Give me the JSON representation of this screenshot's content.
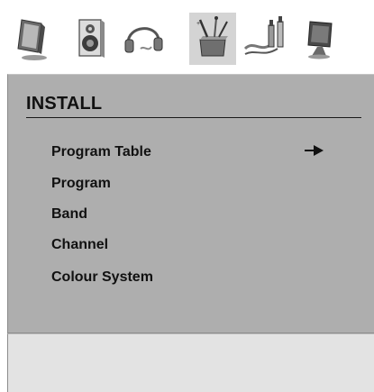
{
  "toolbar": {
    "icons": [
      {
        "name": "tv-screen-icon",
        "active": false
      },
      {
        "name": "speaker-icon",
        "active": false
      },
      {
        "name": "headphones-icon",
        "active": false
      },
      {
        "name": "tools-box-icon",
        "active": true
      },
      {
        "name": "av-cables-icon",
        "active": false
      },
      {
        "name": "monitor-settings-icon",
        "active": false
      }
    ]
  },
  "menu": {
    "title": "INSTALL",
    "items": [
      {
        "label": "Program Table",
        "selected": true
      },
      {
        "label": "Program",
        "selected": false
      },
      {
        "label": "Band",
        "selected": false
      },
      {
        "label": "Channel",
        "selected": false
      },
      {
        "label": "Colour System",
        "selected": false
      }
    ]
  },
  "colors": {
    "panel_bg": "#aeaeae",
    "active_tab_bg": "#d4d4d4",
    "footer_bg": "#e3e3e3",
    "text": "#111111"
  }
}
